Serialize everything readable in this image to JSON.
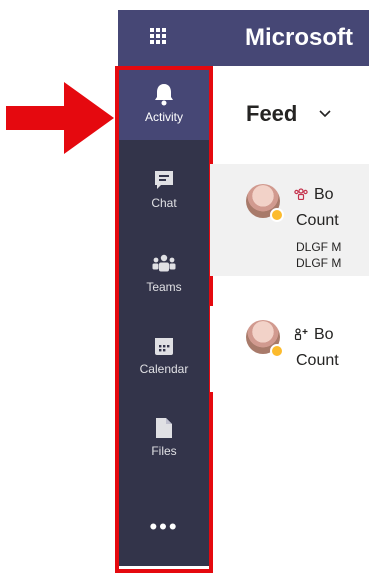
{
  "app": {
    "title": "Microsoft"
  },
  "rail": {
    "items": [
      {
        "label": "Activity",
        "icon": "bell-icon",
        "active": true
      },
      {
        "label": "Chat",
        "icon": "chat-icon"
      },
      {
        "label": "Teams",
        "icon": "teams-icon"
      },
      {
        "label": "Calendar",
        "icon": "calendar-icon"
      },
      {
        "label": "Files",
        "icon": "file-icon"
      }
    ],
    "more_label": "•••"
  },
  "feed": {
    "title": "Feed",
    "items": [
      {
        "icon": "people-icon",
        "heading": "Bo",
        "subtitle": "Count",
        "detail1": "DLGF M",
        "detail2": "DLGF M"
      },
      {
        "icon": "add-people-icon",
        "heading": "Bo",
        "subtitle": "Count"
      }
    ]
  },
  "colors": {
    "rail_bg": "#33344a",
    "topbar_bg": "#464775",
    "highlight_red": "#e5090f",
    "status_away": "#fcbb2d"
  }
}
